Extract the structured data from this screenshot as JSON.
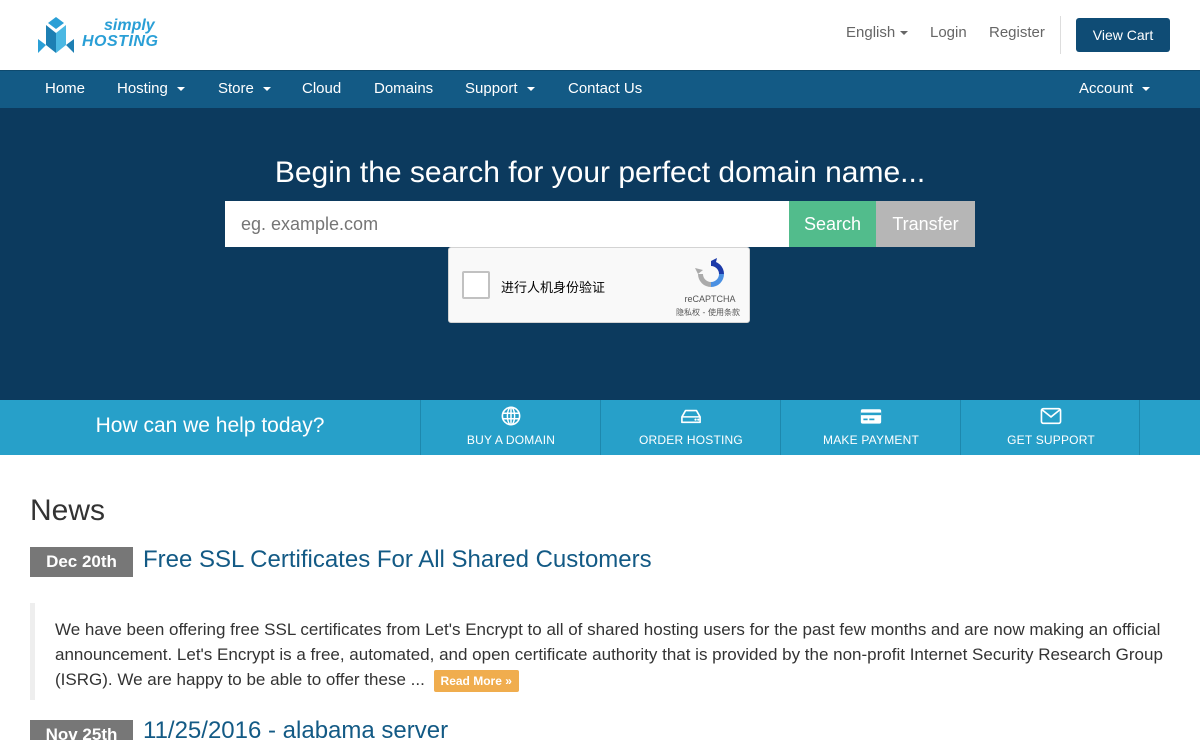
{
  "brand": {
    "line1": "simply",
    "line2": "HOSTING"
  },
  "header": {
    "language": "English",
    "login": "Login",
    "register": "Register",
    "view_cart": "View Cart"
  },
  "nav": {
    "home": "Home",
    "hosting": "Hosting",
    "store": "Store",
    "cloud": "Cloud",
    "domains": "Domains",
    "support": "Support",
    "contact": "Contact Us",
    "account": "Account"
  },
  "hero": {
    "title": "Begin the search for your perfect domain name...",
    "placeholder": "eg. example.com",
    "search": "Search",
    "transfer": "Transfer"
  },
  "captcha": {
    "label": "进行人机身份验证",
    "brand": "reCAPTCHA",
    "links": "隐私权 - 使用条款"
  },
  "help": {
    "title": "How can we help today?",
    "items": [
      {
        "label": "BUY A DOMAIN",
        "icon": "globe-icon"
      },
      {
        "label": "ORDER HOSTING",
        "icon": "hdd-icon"
      },
      {
        "label": "MAKE PAYMENT",
        "icon": "credit-card-icon"
      },
      {
        "label": "GET SUPPORT",
        "icon": "envelope-icon"
      }
    ]
  },
  "news": {
    "title": "News",
    "items": [
      {
        "date": "Dec 20th",
        "headline": "Free SSL Certificates For All Shared Customers",
        "body": "We have been offering free SSL certificates from Let's Encrypt to all of shared hosting users for the past few months and are now making an official announcement. Let's Encrypt is a free, automated, and open certificate authority that is provided by the non-profit Internet Security Research Group (ISRG).  We are happy to be able to offer these ...",
        "read_more": "Read More »"
      },
      {
        "date": "Nov 25th",
        "headline": "11/25/2016 - alabama server"
      }
    ]
  },
  "colors": {
    "nav": "#135a85",
    "hero": "#0c3a5e",
    "helpbar": "#27a0c9",
    "search": "#52bc8c",
    "readmore": "#f0ad4e"
  }
}
